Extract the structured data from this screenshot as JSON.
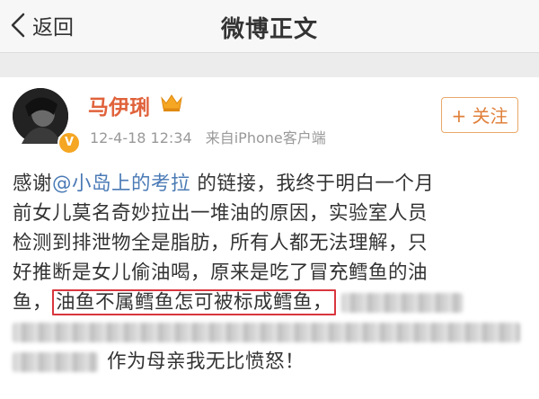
{
  "navbar": {
    "back_label": "返回",
    "title": "微博正文"
  },
  "post": {
    "username": "马伊琍",
    "timestamp": "12-4-18 12:34",
    "source": "来自iPhone客户端",
    "follow_label": "+ 关注",
    "verified_icon": "v-badge-icon",
    "lines": {
      "l1_prefix": "感谢",
      "l1_mention": "@小岛上的考拉",
      "l1_suffix": " 的链接，我终于明白一个月",
      "l2": "前女儿莫名奇妙拉出一堆油的原因，实验室人员",
      "l3": "检测到排泄物全是脂肪，所有人都无法理解，只",
      "l4": "好推断是女儿偷油喝，原来是吃了冒充鳕鱼的油",
      "l5_prefix": "鱼，",
      "l5_highlight": "油鱼不属鳕鱼怎可被标成鳕鱼，",
      "l7_suffix": "作为母亲我无比愤怒！"
    }
  },
  "colors": {
    "username": "#e0623b",
    "mention": "#4a7ab5",
    "highlight_border": "#d9363e",
    "follow_border": "#e8a96a"
  }
}
